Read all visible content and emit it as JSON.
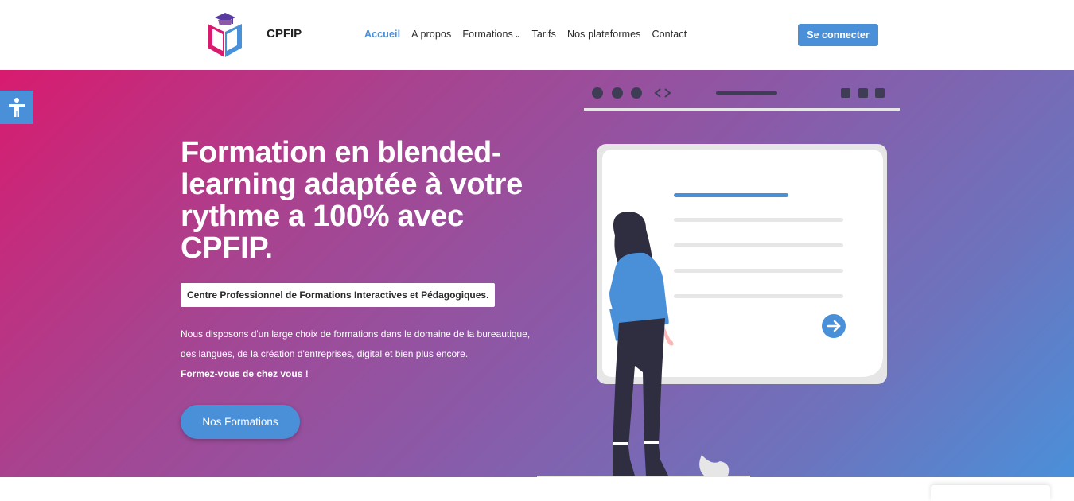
{
  "header": {
    "brand": "CPFIP",
    "nav": [
      {
        "label": "Accueil",
        "active": true
      },
      {
        "label": "A propos"
      },
      {
        "label": "Formations",
        "dropdown": true
      },
      {
        "label": "Tarifs"
      },
      {
        "label": "Nos plateformes"
      },
      {
        "label": "Contact"
      }
    ],
    "login_label": "Se connecter"
  },
  "hero": {
    "headline": "Formation en blended-learning adaptée à votre rythme a 100% avec CPFIP.",
    "tagline": "Centre Professionnel de Formations Interactives et Pédagogiques.",
    "description_line1": "Nous disposons d'un large choix de formations dans le domaine de la bureautique,",
    "description_line2": "des langues, de la création d'entreprises, digital et bien plus encore.",
    "description_bold": "Formez-vous de chez vous !",
    "cta_label": "Nos Formations"
  },
  "colors": {
    "accent": "#4a90d9",
    "gradient_start": "#d81b6f",
    "gradient_end": "#4a90d9"
  },
  "icons": [
    "accessibility-icon",
    "chevron-down-icon",
    "arrow-right-icon"
  ]
}
